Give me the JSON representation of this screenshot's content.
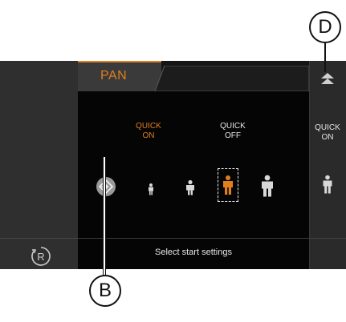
{
  "tab": {
    "label": "PAN"
  },
  "quick_on": {
    "line1": "QUICK",
    "line2": "ON"
  },
  "quick_off": {
    "line1": "QUICK",
    "line2": "OFF"
  },
  "side_quick_on": {
    "line1": "QUICK",
    "line2": "ON"
  },
  "status": {
    "text": "Select start settings"
  },
  "callouts": {
    "d": "D",
    "b": "B"
  },
  "colors": {
    "accent": "#e07f1f",
    "screen_bg": "#000000",
    "rail": "#2f2f2f"
  },
  "icons": {
    "left_bottom": "r-circle-icon",
    "top_right": "double-chevron-up-icon",
    "enter": "arrow-right-into-diamond-icon"
  },
  "selected_size_index": 3,
  "person_sizes": [
    "xs",
    "s",
    "m",
    "l"
  ]
}
